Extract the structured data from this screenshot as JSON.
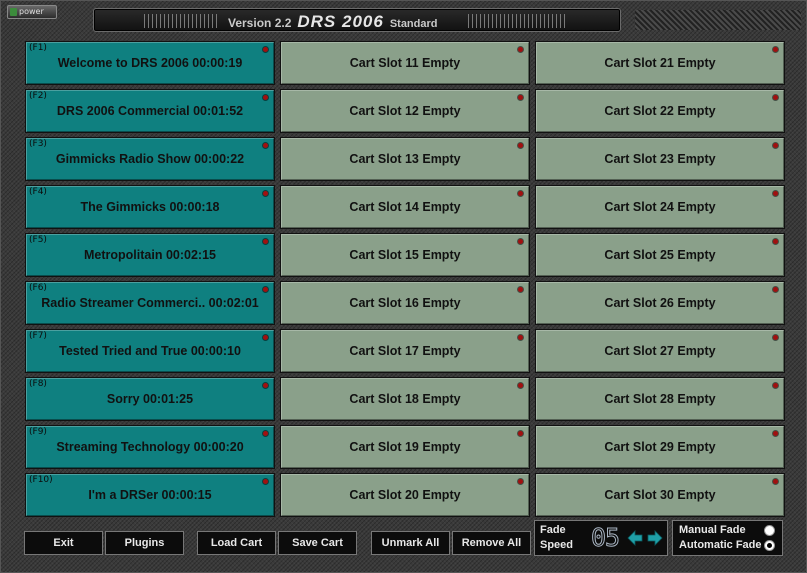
{
  "header": {
    "power_label": "power",
    "version": "Version 2.2",
    "product": "DRS 2006",
    "edition": "Standard"
  },
  "carts": [
    {
      "key": "(F1)",
      "label": "Welcome to DRS 2006 00:00:19",
      "state": "loaded"
    },
    {
      "key": "(F2)",
      "label": "DRS 2006 Commercial 00:01:52",
      "state": "loaded"
    },
    {
      "key": "(F3)",
      "label": "Gimmicks Radio Show 00:00:22",
      "state": "loaded"
    },
    {
      "key": "(F4)",
      "label": "The Gimmicks 00:00:18",
      "state": "loaded"
    },
    {
      "key": "(F5)",
      "label": "Metropolitain 00:02:15",
      "state": "loaded"
    },
    {
      "key": "(F6)",
      "label": "Radio Streamer Commerci.. 00:02:01",
      "state": "loaded"
    },
    {
      "key": "(F7)",
      "label": "Tested Tried and True 00:00:10",
      "state": "loaded"
    },
    {
      "key": "(F8)",
      "label": "Sorry 00:01:25",
      "state": "loaded"
    },
    {
      "key": "(F9)",
      "label": "Streaming Technology 00:00:20",
      "state": "loaded"
    },
    {
      "key": "(F10)",
      "label": "I'm a DRSer 00:00:15",
      "state": "loaded"
    },
    {
      "key": "",
      "label": "Cart Slot 11 Empty",
      "state": "empty"
    },
    {
      "key": "",
      "label": "Cart Slot 12 Empty",
      "state": "empty"
    },
    {
      "key": "",
      "label": "Cart Slot 13 Empty",
      "state": "empty"
    },
    {
      "key": "",
      "label": "Cart Slot 14 Empty",
      "state": "empty"
    },
    {
      "key": "",
      "label": "Cart Slot 15 Empty",
      "state": "empty"
    },
    {
      "key": "",
      "label": "Cart Slot 16 Empty",
      "state": "empty"
    },
    {
      "key": "",
      "label": "Cart Slot 17 Empty",
      "state": "empty"
    },
    {
      "key": "",
      "label": "Cart Slot 18 Empty",
      "state": "empty"
    },
    {
      "key": "",
      "label": "Cart Slot 19 Empty",
      "state": "empty"
    },
    {
      "key": "",
      "label": "Cart Slot 20 Empty",
      "state": "empty"
    },
    {
      "key": "",
      "label": "Cart Slot 21 Empty",
      "state": "empty"
    },
    {
      "key": "",
      "label": "Cart Slot 22 Empty",
      "state": "empty"
    },
    {
      "key": "",
      "label": "Cart Slot 23 Empty",
      "state": "empty"
    },
    {
      "key": "",
      "label": "Cart Slot 24 Empty",
      "state": "empty"
    },
    {
      "key": "",
      "label": "Cart Slot 25 Empty",
      "state": "empty"
    },
    {
      "key": "",
      "label": "Cart Slot 26 Empty",
      "state": "empty"
    },
    {
      "key": "",
      "label": "Cart Slot 27 Empty",
      "state": "empty"
    },
    {
      "key": "",
      "label": "Cart Slot 28 Empty",
      "state": "empty"
    },
    {
      "key": "",
      "label": "Cart Slot 29 Empty",
      "state": "empty"
    },
    {
      "key": "",
      "label": "Cart Slot 30 Empty",
      "state": "empty"
    }
  ],
  "toolbar": {
    "exit": "Exit",
    "plugins": "Plugins",
    "load_cart": "Load Cart",
    "save_cart": "Save Cart",
    "unmark_all": "Unmark All",
    "remove_all": "Remove All"
  },
  "fade": {
    "label_line1": "Fade",
    "label_line2": "Speed",
    "speed_value": "05",
    "left_arrow_icon": "arrow-left-icon",
    "right_arrow_icon": "arrow-right-icon"
  },
  "fade_mode": {
    "manual_label": "Manual Fade",
    "automatic_label": "Automatic Fade",
    "selected": "automatic"
  },
  "colors": {
    "loaded_cart": "#0f8080",
    "empty_cart": "#8aa08a",
    "led": "#a01010",
    "arrow": "#1fa0a8"
  }
}
